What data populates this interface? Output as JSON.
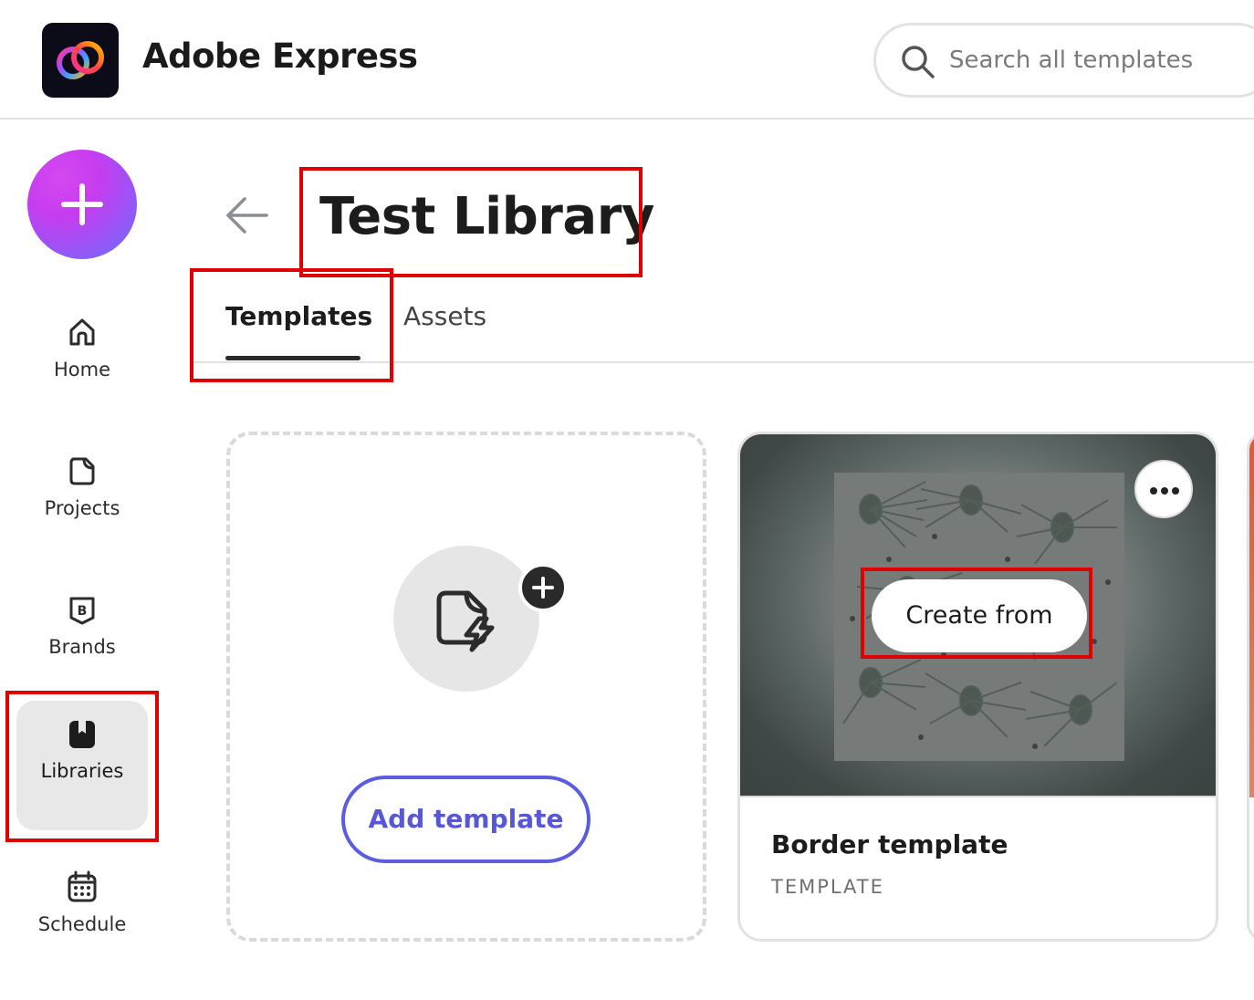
{
  "header": {
    "app_title": "Adobe Express",
    "search_placeholder": "Search all templates"
  },
  "sidebar": {
    "create_button": "+",
    "items": [
      {
        "label": "Home",
        "icon": "home-icon",
        "active": false
      },
      {
        "label": "Projects",
        "icon": "projects-icon",
        "active": false
      },
      {
        "label": "Brands",
        "icon": "brands-icon",
        "active": false
      },
      {
        "label": "Libraries",
        "icon": "libraries-icon",
        "active": true
      },
      {
        "label": "Schedule",
        "icon": "schedule-icon",
        "active": false
      }
    ]
  },
  "page": {
    "title": "Test Library",
    "tabs": [
      {
        "label": "Templates",
        "selected": true
      },
      {
        "label": "Assets",
        "selected": false
      }
    ]
  },
  "cards": {
    "add_template": {
      "button_label": "Add template"
    },
    "templates": [
      {
        "name": "Border template",
        "type": "TEMPLATE",
        "hover_action": "Create from"
      }
    ]
  },
  "colors": {
    "accent_purple": "#5858d6",
    "highlight_red": "#e00000",
    "active_nav_bg": "#e8e8e8"
  }
}
